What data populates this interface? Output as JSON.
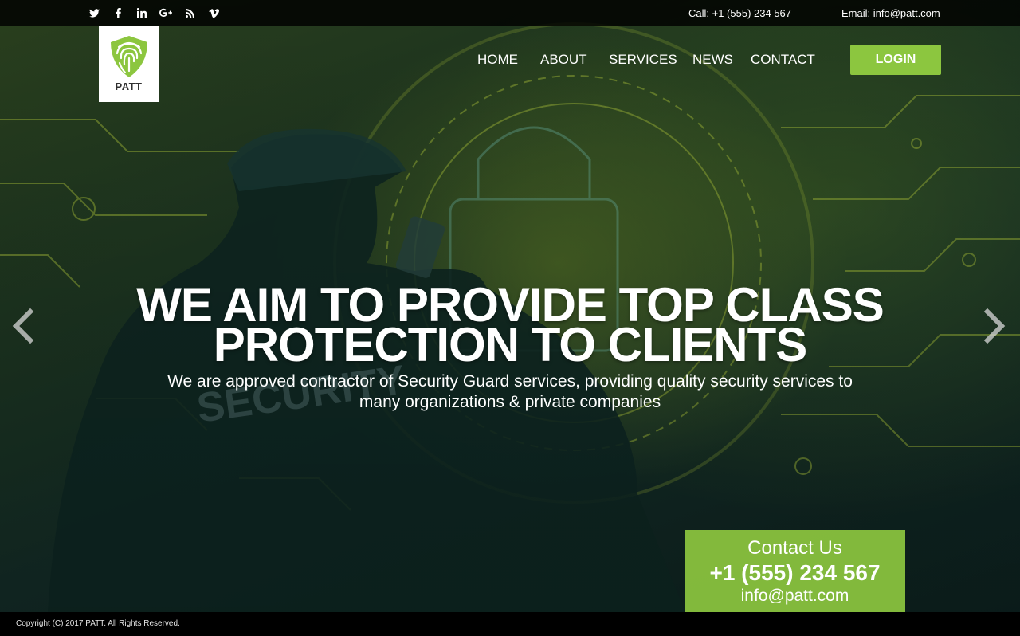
{
  "social": [
    {
      "name": "twitter-icon",
      "glyph": "twitter"
    },
    {
      "name": "facebook-icon",
      "glyph": "facebook"
    },
    {
      "name": "linkedin-icon",
      "glyph": "linkedin"
    },
    {
      "name": "google-plus-icon",
      "glyph": "google-plus"
    },
    {
      "name": "rss-icon",
      "glyph": "rss"
    },
    {
      "name": "vimeo-icon",
      "glyph": "vimeo"
    }
  ],
  "topbar": {
    "call": "Call: +1 (555) 234 567",
    "email": "Email: info@patt.com"
  },
  "logo": {
    "text": "PATT"
  },
  "nav": {
    "home": "HOME",
    "about": "ABOUT",
    "services": "SERVICES",
    "news": "NEWS",
    "contact": "CONTACT",
    "login": "LOGIN"
  },
  "hero": {
    "headline": "WE AIM TO PROVIDE TOP CLASS PROTECTION TO CLIENTS",
    "subline": "We are approved contractor of Security Guard services, providing quality security services to many organizations & private companies"
  },
  "contact_box": {
    "title": "Contact Us",
    "phone": "+1 (555) 234 567",
    "email": "info@patt.com"
  },
  "footer": {
    "copyright": "Copyright (C) 2017 PATT. All Rights Reserved."
  },
  "colors": {
    "accent": "#8cc63f",
    "topbar": "#000000",
    "footer": "#000000"
  }
}
